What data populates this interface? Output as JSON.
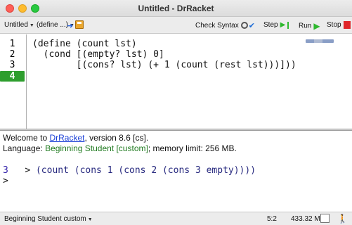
{
  "window": {
    "title": "Untitled - DrRacket"
  },
  "toolbar": {
    "file_menu": "Untitled",
    "define_menu": "(define ...)",
    "check_syntax": "Check Syntax",
    "step": "Step",
    "run": "Run",
    "stop": "Stop"
  },
  "editor": {
    "line_numbers": [
      "1",
      "2",
      "3",
      "4"
    ],
    "active_line": "4",
    "lines": [
      "(define (count lst)",
      "  (cond [(empty? lst) 0]",
      "        [(cons? lst) (+ 1 (count (rest lst)))]))"
    ]
  },
  "interactions": {
    "welcome_prefix": "Welcome to ",
    "welcome_link": "DrRacket",
    "welcome_suffix": ", version 8.6 [cs].",
    "language_prefix": "Language: ",
    "language_name": "Beginning Student [custom]",
    "language_suffix": "; memory limit: 256 MB.",
    "prompt": ">",
    "expression": "(count (cons 1 (cons 2 (cons 3 empty))))",
    "result": "3",
    "empty_prompt": ">"
  },
  "status": {
    "language": "Beginning Student custom",
    "position": "5:2",
    "memory": "433.32 MB"
  },
  "icons": [
    "close-icon",
    "minimize-icon",
    "maximize-icon",
    "arrow-icon",
    "save-icon",
    "magnifier-icon",
    "checkmark-icon",
    "step-icon",
    "run-icon",
    "stop-icon",
    "walker-icon"
  ],
  "colors": {
    "active_line": "#2e9e2e",
    "run_green": "#2eb82e",
    "stop_red": "#e0262a",
    "link_blue": "#1a3fd6",
    "language_green": "#1f7a1f"
  }
}
